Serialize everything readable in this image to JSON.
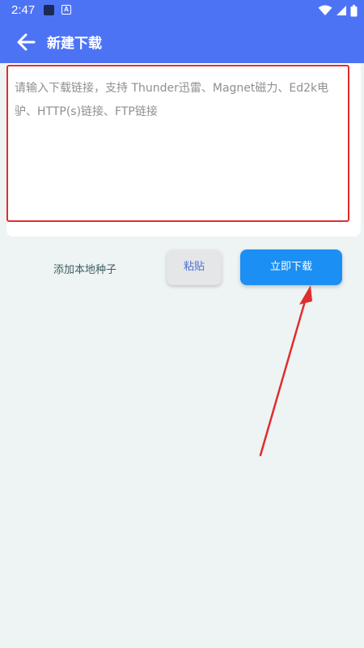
{
  "status_bar": {
    "time": "2:47",
    "notification_badge": "A",
    "icons": [
      "app-notification-icon",
      "a-badge-icon",
      "wifi-icon",
      "cellular-signal-icon",
      "battery-icon"
    ]
  },
  "toolbar": {
    "title": "新建下载",
    "back_icon": "arrow-left-icon"
  },
  "link_input": {
    "value": "",
    "placeholder": "请输入下载链接，支持 Thunder迅雷、Magnet磁力、Ed2k电驴、HTTP(s)链接、FTP链接"
  },
  "actions": {
    "local_torrent_label": "添加本地种子",
    "paste_label": "粘贴",
    "download_label": "立即下载"
  },
  "colors": {
    "header": "#4d73f5",
    "primary_button": "#1b8ff4",
    "highlight": "#e02d2d",
    "background": "#eef3f4"
  }
}
